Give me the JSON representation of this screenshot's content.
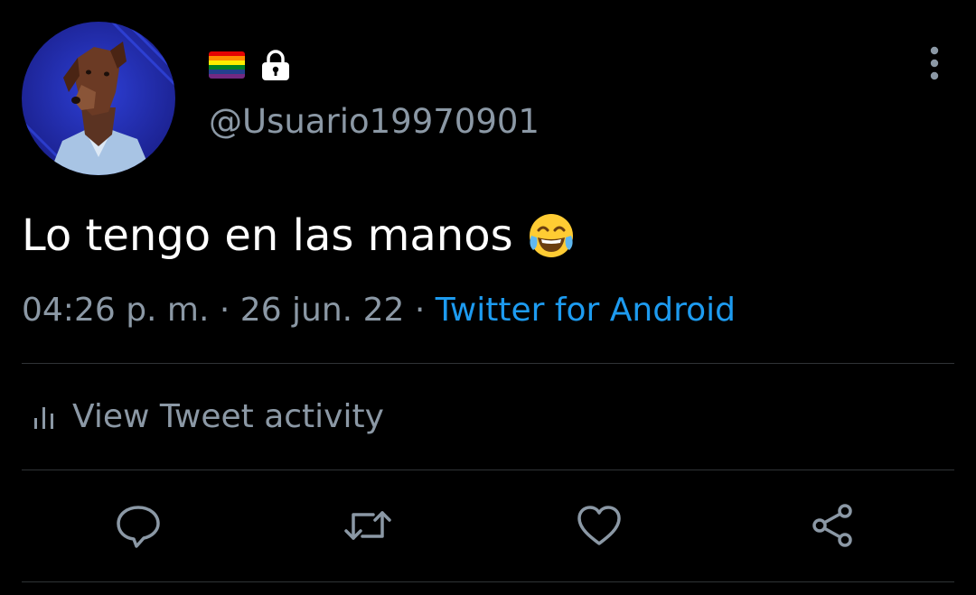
{
  "tweet": {
    "handle": "@Usuario19970901",
    "text": "Lo tengo en las manos",
    "emoji": "face-with-tears-of-joy-icon",
    "time": "04:26 p. m.",
    "separator": " · ",
    "date": "26 jun. 22",
    "source": "Twitter for Android"
  },
  "user": {
    "avatar": "avatar-doberman-in-shirt",
    "badges": [
      "rainbow-flag-icon",
      "lock-icon"
    ]
  },
  "activity": {
    "label": "View Tweet activity",
    "icon": "bar-chart-icon"
  },
  "actions": {
    "icons": [
      "reply-icon",
      "retweet-icon",
      "like-icon",
      "share-icon"
    ]
  },
  "colors": {
    "background": "#000000",
    "primary_text": "#ffffff",
    "secondary_text": "#8b98a5",
    "link": "#1d9bf0",
    "divider": "#2f3336"
  }
}
